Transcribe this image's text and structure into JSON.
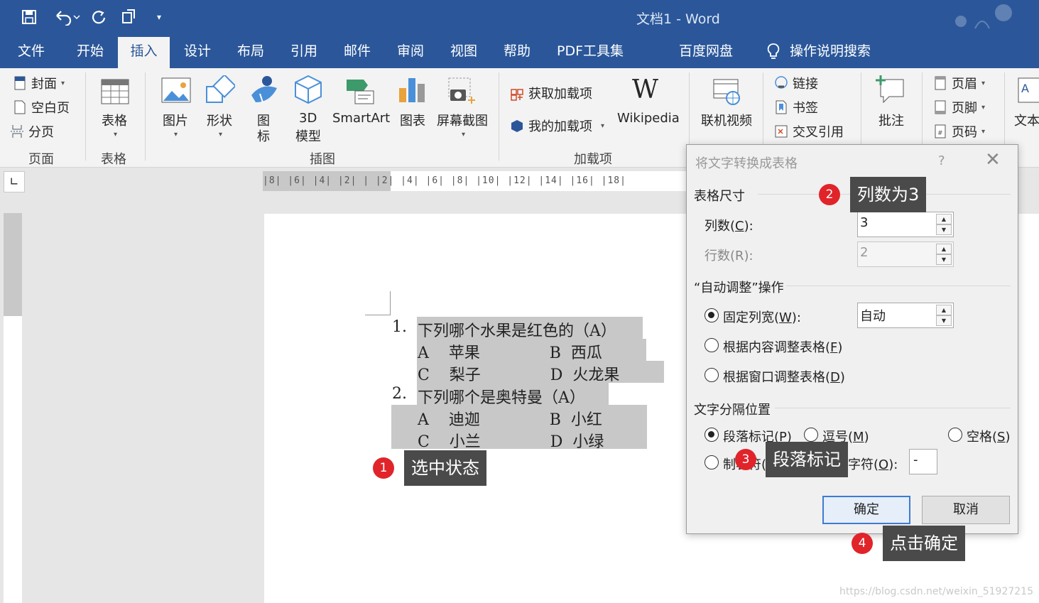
{
  "window": {
    "title": "文档1  -  Word"
  },
  "menu_tabs": [
    "文件",
    "开始",
    "插入",
    "设计",
    "布局",
    "引用",
    "邮件",
    "审阅",
    "视图",
    "帮助",
    "PDF工具集",
    "百度网盘",
    "操作说明搜索"
  ],
  "active_tab": "插入",
  "ribbon": {
    "pages": {
      "cover": "封面",
      "blank": "空白页",
      "break": "分页",
      "label": "页面"
    },
    "tables": {
      "table": "表格",
      "label": "表格"
    },
    "illustrations": {
      "pictures": "图片",
      "shapes": "形状",
      "icons_l1": "图",
      "icons_l2": "标",
      "model_l1": "3D",
      "model_l2": "模型",
      "smartart": "SmartArt",
      "chart": "图表",
      "screenshot": "屏幕截图",
      "label": "插图"
    },
    "addins": {
      "get": "获取加载项",
      "mine": "我的加载项",
      "wiki": "Wikipedia",
      "label": "加载项"
    },
    "media": {
      "video": "联机视频"
    },
    "links": {
      "link": "链接",
      "bookmark": "书签",
      "crossref": "交叉引用"
    },
    "comments": {
      "comment": "批注"
    },
    "header_footer": {
      "header": "页眉",
      "footer": "页脚",
      "page_number": "页码"
    },
    "text": {
      "textbox": "文本"
    }
  },
  "ruler": {
    "ticks": "|8|  |6|  |4|  |2|  |  |2|  |4|  |6|  |8|  |10|  |12|  |14|  |16|  |18|"
  },
  "document": {
    "lines": [
      {
        "num": "1.",
        "text": "下列哪个水果是红色的（A）"
      },
      {
        "num": "",
        "text": "A    苹果              B  西瓜"
      },
      {
        "num": "",
        "text": "C    梨子              D  火龙果"
      },
      {
        "num": "2.",
        "text": "下列哪个是奥特曼（A）"
      },
      {
        "num": "",
        "text": "A    迪迦              B  小红"
      },
      {
        "num": "",
        "text": "C    小兰              D  小绿"
      }
    ]
  },
  "dialog": {
    "title": "将文字转换成表格",
    "help": "?",
    "close": "✕",
    "section_size": "表格尺寸",
    "columns_label_pre": "列数(",
    "columns_key": "C",
    "columns_label_post": "):",
    "columns_value": "3",
    "rows_label": "行数(R):",
    "rows_value": "2",
    "section_autofit": "“自动调整”操作",
    "fixed_pre": "固定列宽(",
    "fixed_key": "W",
    "fixed_post": "):",
    "fixed_value": "自动",
    "fit_content_pre": "根据内容调整表格(",
    "fit_content_key": "F",
    "fit_content_post": ")",
    "fit_window_pre": "根据窗口调整表格(",
    "fit_window_key": "D",
    "fit_window_post": ")",
    "section_separator": "文字分隔位置",
    "para_pre": "段落标记(",
    "para_key": "P",
    "para_post": ")",
    "comma_pre": "逗号(",
    "comma_key": "M",
    "comma_post": ")",
    "space_pre": "空格(",
    "space_key": "S",
    "space_post": ")",
    "tab_label": "制表符(T)",
    "other_pre": "其他字符(",
    "other_key": "O",
    "other_post": "):",
    "other_value": "-",
    "ok": "确定",
    "cancel": "取消"
  },
  "annotations": [
    {
      "num": "1",
      "text": "选中状态"
    },
    {
      "num": "2",
      "text": "列数为3"
    },
    {
      "num": "3",
      "text": "段落标记"
    },
    {
      "num": "4",
      "text": "点击确定"
    }
  ],
  "watermark": "https://blog.csdn.net/weixin_51927215",
  "colors": {
    "word_blue": "#2b579a",
    "badge_red": "#e0242a",
    "tooltip_bg": "#4a4a4a",
    "selection": "#c8c8c8"
  }
}
